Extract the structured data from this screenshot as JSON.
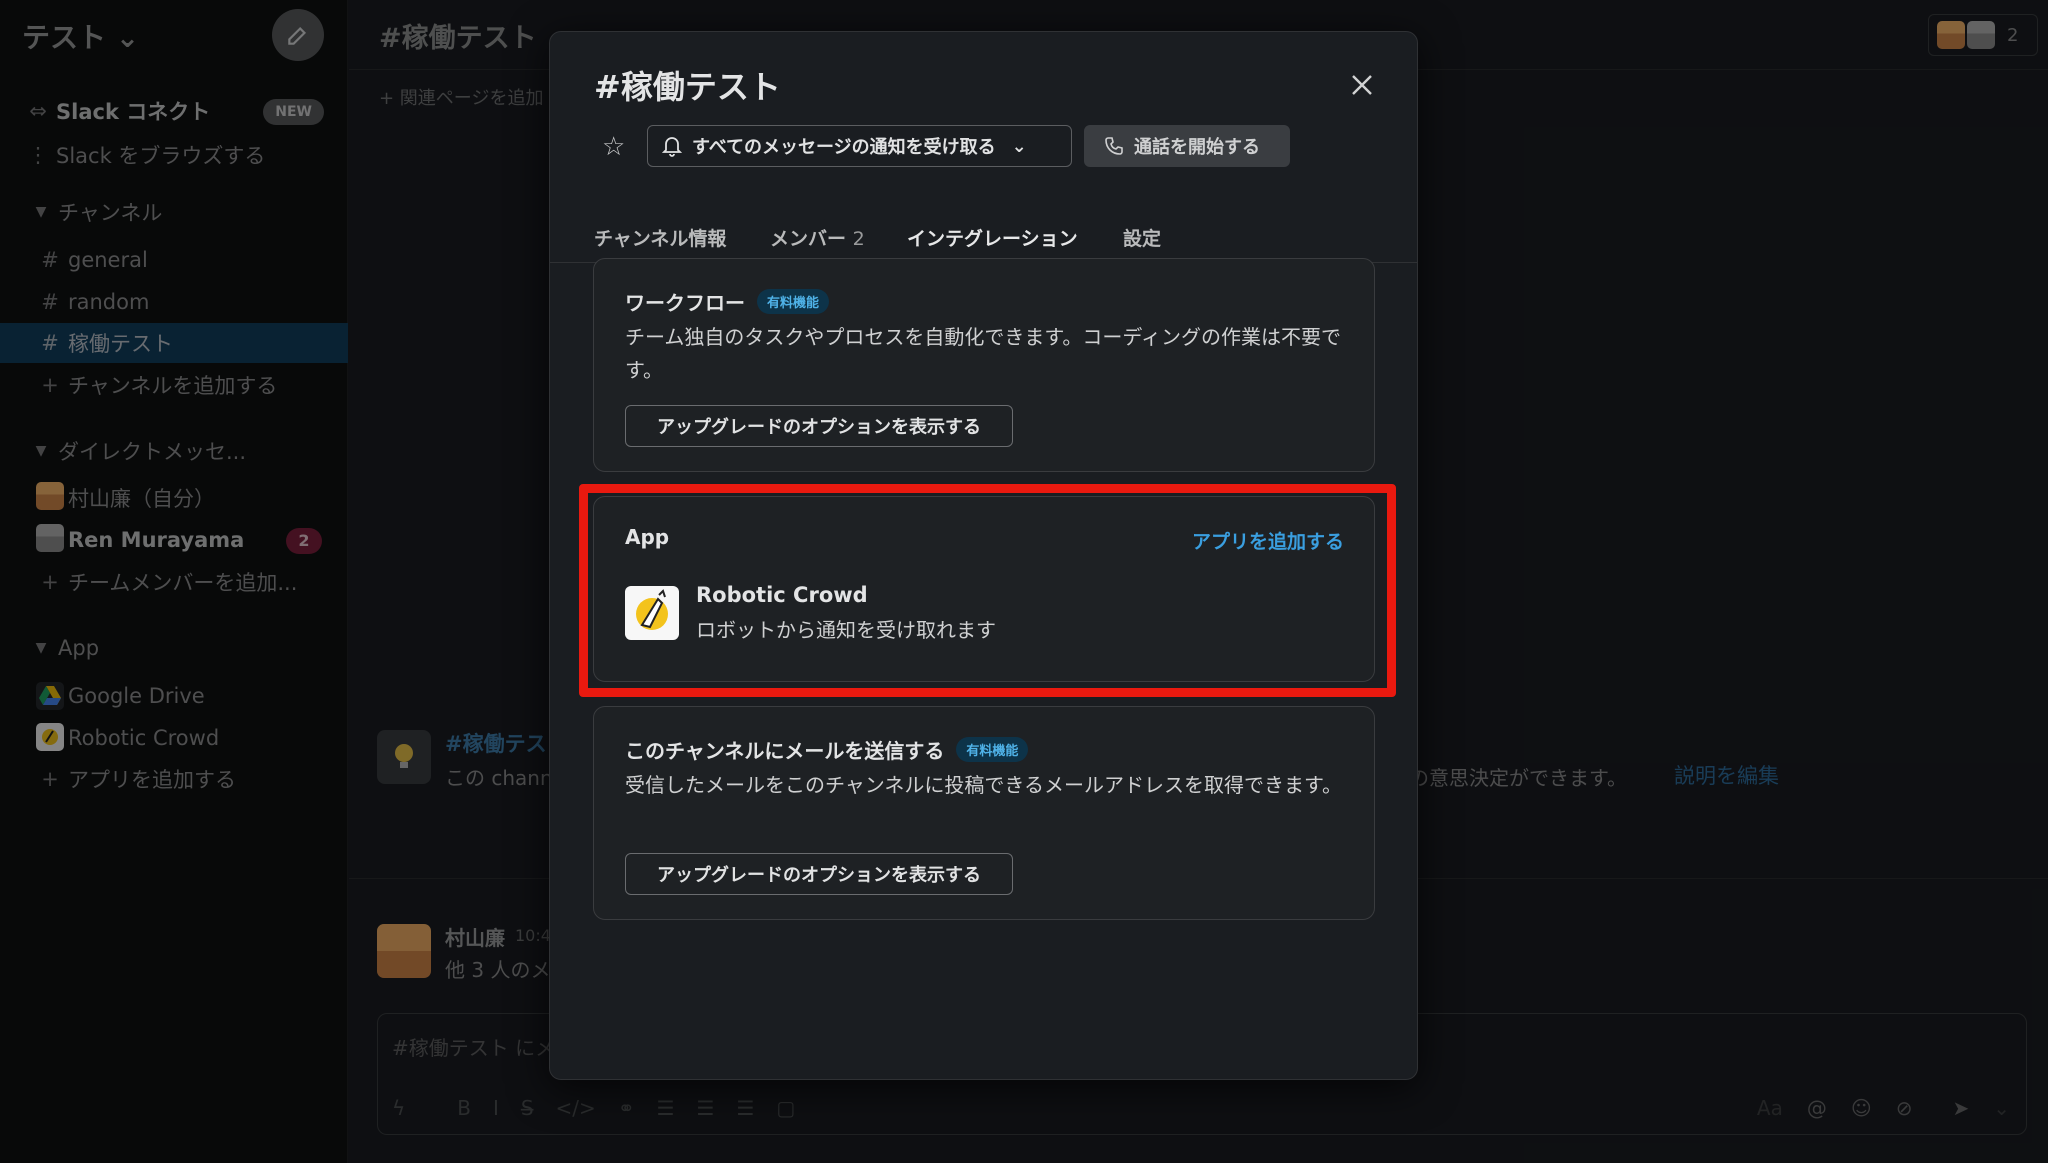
{
  "workspace": {
    "name": "テスト ⌄"
  },
  "sidebar": {
    "connect": {
      "label": "Slack コネクト",
      "badge": "NEW"
    },
    "browse": {
      "label": "Slack をブラウズする"
    },
    "channels_header": "チャンネル",
    "channels": [
      {
        "label": "general"
      },
      {
        "label": "random"
      },
      {
        "label": "稼働テスト"
      }
    ],
    "add_channel": "チャンネルを追加する",
    "dm_header": "ダイレクトメッセ...",
    "dms": [
      {
        "label": "村山廉（自分）"
      },
      {
        "label": "Ren Murayama",
        "badge": "2"
      }
    ],
    "add_member": "チームメンバーを追加...",
    "app_header": "App",
    "apps": [
      {
        "label": "Google Drive"
      },
      {
        "label": "Robotic Crowd"
      }
    ],
    "add_app": "アプリを追加する"
  },
  "main": {
    "channel_title": "#稼働テスト ⌄",
    "member_count": "2",
    "bookmark": "+ 関連ページを追加",
    "hint_title": "#稼働テス",
    "hint_text": "この chann",
    "hint_text_right": "の意思決定ができます。",
    "edit_desc": "説明を編集",
    "message": {
      "name": "村山廉",
      "time": "10:4",
      "text": "他 3 人のメ"
    },
    "composer_placeholder": "#稼働テスト にメ"
  },
  "modal": {
    "title": "#稼働テスト",
    "notif_button": "すべてのメッセージの通知を受け取る",
    "call_button": "通話を開始する",
    "tabs": [
      {
        "label": "チャンネル情報"
      },
      {
        "label": "メンバー",
        "count": "2"
      },
      {
        "label": "インテグレーション"
      },
      {
        "label": "設定"
      }
    ],
    "workflow": {
      "title": "ワークフロー",
      "badge": "有料機能",
      "desc": "チーム独自のタスクやプロセスを自動化できます。コーディングの作業は不要です。",
      "button": "アップグレードのオプションを表示する"
    },
    "app": {
      "title": "App",
      "add_link": "アプリを追加する",
      "item_name": "Robotic Crowd",
      "item_desc": "ロボットから通知を受け取れます"
    },
    "email": {
      "title": "このチャンネルにメールを送信する",
      "badge": "有料機能",
      "desc": "受信したメールをこのチャンネルに投稿できるメールアドレスを取得できます。",
      "button": "アップグレードのオプションを表示する"
    }
  },
  "colors": {
    "accent_tab": "#2bac76",
    "highlight": "#e9190f",
    "link": "#3a9fe0",
    "active_channel": "#123e5e"
  }
}
